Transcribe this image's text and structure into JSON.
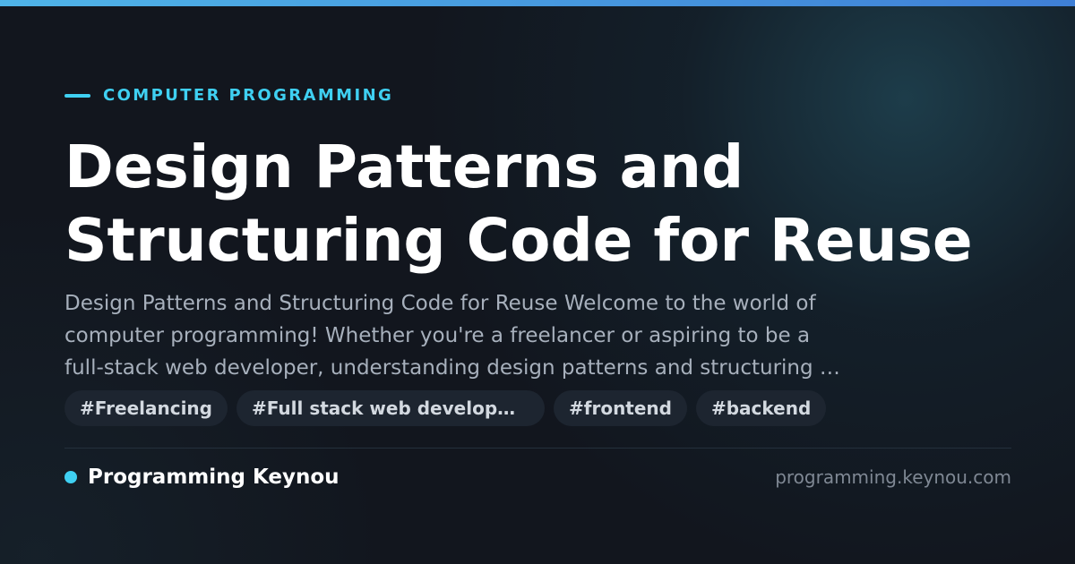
{
  "colors": {
    "accent": "#3fd0f2",
    "top_bar_start": "#4fb4e8",
    "top_bar_end": "#3f7fd6",
    "background": "#12161e",
    "tag_background": "#1d2530",
    "description_text": "#a7b0bc",
    "url_text": "#7f8894"
  },
  "card": {
    "category": "COMPUTER PROGRAMMING",
    "title": "Design Patterns and\nStructuring Code for Reuse",
    "description": "Design Patterns and Structuring Code for Reuse Welcome to the world of\ncomputer programming! Whether you're a freelancer or aspiring to be a\nfull-stack web developer, understanding design patterns and structuring …",
    "tags": [
      "#Freelancing",
      "#Full stack web developm…",
      "#frontend",
      "#backend"
    ]
  },
  "footer": {
    "brand": "Programming Keynou",
    "url": "programming.keynou.com"
  }
}
